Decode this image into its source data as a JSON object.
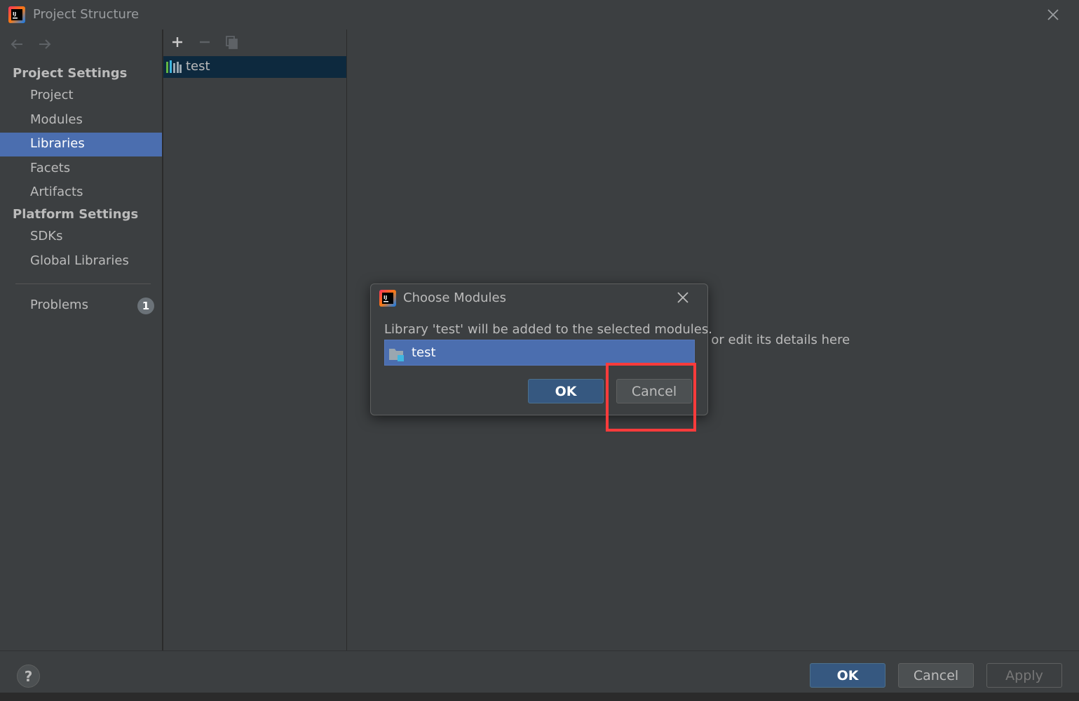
{
  "window": {
    "title": "Project Structure"
  },
  "sidebar": {
    "sections": [
      {
        "title": "Project Settings"
      },
      {
        "title": "Platform Settings"
      }
    ],
    "items": [
      {
        "label": "Project"
      },
      {
        "label": "Modules"
      },
      {
        "label": "Libraries"
      },
      {
        "label": "Facets"
      },
      {
        "label": "Artifacts"
      },
      {
        "label": "SDKs"
      },
      {
        "label": "Global Libraries"
      },
      {
        "label": "Problems"
      }
    ],
    "selected": "Libraries",
    "problems_count": "1"
  },
  "library_list": {
    "items": [
      {
        "label": "test"
      }
    ],
    "toolbar_icons": [
      "add-icon",
      "remove-icon",
      "copy-icon"
    ]
  },
  "main": {
    "hint_text": "v or edit its details here"
  },
  "dialog": {
    "title": "Choose Modules",
    "message": "Library 'test' will be added to the selected modules.",
    "modules": [
      {
        "label": "test"
      }
    ],
    "ok_label": "OK",
    "cancel_label": "Cancel"
  },
  "footer": {
    "help_label": "?",
    "ok_label": "OK",
    "cancel_label": "Cancel",
    "apply_label": "Apply"
  },
  "colors": {
    "background": "#3c3f41",
    "selection": "#4b6eaf",
    "primary_button": "#365880",
    "highlight": "#ff3b3b"
  }
}
